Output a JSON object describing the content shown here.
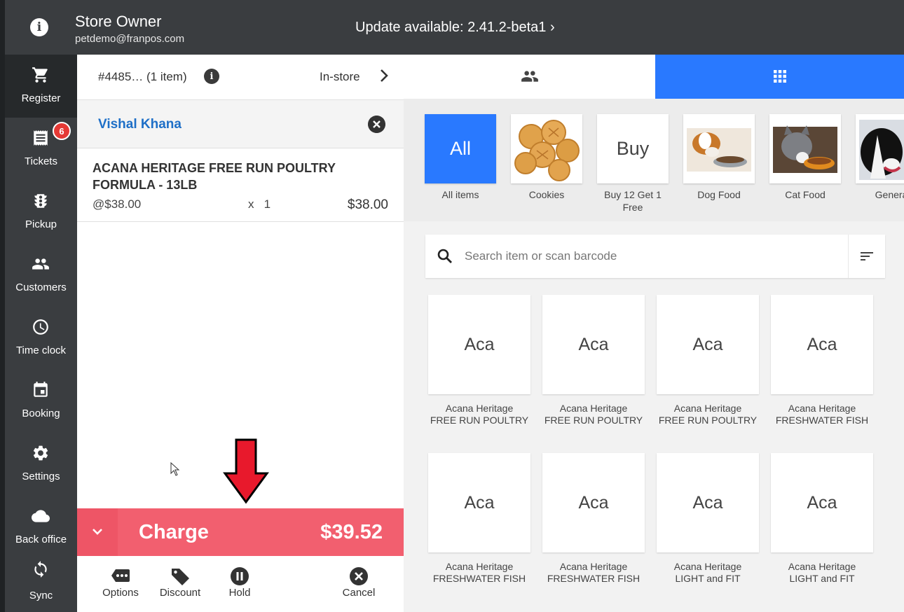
{
  "user": {
    "name": "Store Owner",
    "email": "petdemo@franpos.com"
  },
  "update_text": "Update available: 2.41.2-beta1 ›",
  "sidebar": {
    "items": [
      {
        "label": "Register",
        "icon": "cart-icon"
      },
      {
        "label": "Tickets",
        "icon": "receipt-icon",
        "badge": "6"
      },
      {
        "label": "Pickup",
        "icon": "traffic-light-icon"
      },
      {
        "label": "Customers",
        "icon": "people-icon"
      },
      {
        "label": "Time clock",
        "icon": "clock-icon"
      },
      {
        "label": "Booking",
        "icon": "calendar-icon"
      },
      {
        "label": "Settings",
        "icon": "gear-icon"
      },
      {
        "label": "Back office",
        "icon": "cloud-icon"
      },
      {
        "label": "Sync",
        "icon": "sync-icon"
      }
    ]
  },
  "cart": {
    "order_label": "#4485… (1 item)",
    "mode": "In-store",
    "customer": "Vishal Khana",
    "items": [
      {
        "name": "ACANA HERITAGE FREE RUN POULTRY FORMULA - 13LB",
        "unit_price": "@$38.00",
        "qty": "x   1",
        "total": "$38.00"
      }
    ],
    "charge_label": "Charge",
    "charge_amount": "$39.52",
    "actions": [
      {
        "label": "Options",
        "icon": "more-dots-icon"
      },
      {
        "label": "Discount",
        "icon": "tag-icon"
      },
      {
        "label": "Hold",
        "icon": "pause-icon"
      },
      {
        "label": "Cancel",
        "icon": "cancel-icon"
      }
    ]
  },
  "categories": [
    {
      "tile": "All",
      "label": "All items"
    },
    {
      "tile": "",
      "label": "Cookies"
    },
    {
      "tile": "Buy",
      "label": "Buy 12 Get 1 Free"
    },
    {
      "tile": "",
      "label": "Dog Food"
    },
    {
      "tile": "",
      "label": "Cat Food"
    },
    {
      "tile": "",
      "label": "Genera"
    }
  ],
  "search": {
    "placeholder": "Search item or scan barcode"
  },
  "products": [
    {
      "tile": "Aca",
      "line1": "Acana Heritage",
      "line2": "FREE RUN POULTRY"
    },
    {
      "tile": "Aca",
      "line1": "Acana Heritage",
      "line2": "FREE RUN POULTRY"
    },
    {
      "tile": "Aca",
      "line1": "Acana Heritage",
      "line2": "FREE RUN POULTRY"
    },
    {
      "tile": "Aca",
      "line1": "Acana Heritage",
      "line2": "FRESHWATER FISH"
    },
    {
      "tile": "Aca",
      "line1": "Acana Heritage",
      "line2": "FRESHWATER FISH"
    },
    {
      "tile": "Aca",
      "line1": "Acana Heritage",
      "line2": "FRESHWATER FISH"
    },
    {
      "tile": "Aca",
      "line1": "Acana Heritage",
      "line2": "LIGHT and FIT"
    },
    {
      "tile": "Aca",
      "line1": "Acana Heritage",
      "line2": "LIGHT and FIT"
    }
  ],
  "colors": {
    "accent": "#2979ff",
    "charge": "#f25f6f",
    "chrome": "#3a3d40",
    "badge": "#e53935",
    "annotation_arrow": "#e8192c"
  }
}
